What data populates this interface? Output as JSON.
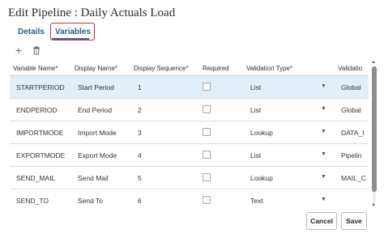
{
  "dialog": {
    "title": "Edit Pipeline : Daily Actuals Load"
  },
  "tabs": [
    {
      "label": "Details"
    },
    {
      "label": "Variables",
      "active": true
    }
  ],
  "toolbar": {
    "add_icon": "plus-icon",
    "delete_icon": "trash-icon"
  },
  "table": {
    "columns": [
      "Variable Name*",
      "Display Name*",
      "Display Sequence*",
      "Required",
      "Validation Type*",
      "Validatio"
    ],
    "rows": [
      {
        "variable": "STARTPERIOD",
        "display": "Start Period",
        "sequence": "1",
        "required": false,
        "validation_type": "List",
        "validation": "Global",
        "selected": true
      },
      {
        "variable": "ENDPERIOD",
        "display": "End Period",
        "sequence": "2",
        "required": false,
        "validation_type": "List",
        "validation": "Global"
      },
      {
        "variable": "IMPORTMODE",
        "display": "Import Mode",
        "sequence": "3",
        "required": false,
        "validation_type": "Lookup",
        "validation": "DATA_I"
      },
      {
        "variable": "EXPORTMODE",
        "display": "Export Mode",
        "sequence": "4",
        "required": false,
        "validation_type": "List",
        "validation": "Pipelin"
      },
      {
        "variable": "SEND_MAIL",
        "display": "Send Mail",
        "sequence": "5",
        "required": false,
        "validation_type": "Lookup",
        "validation": "MAIL_C"
      },
      {
        "variable": "SEND_TO",
        "display": "Send To",
        "sequence": "6",
        "required": false,
        "validation_type": "Text",
        "validation": ""
      }
    ]
  },
  "footer": {
    "cancel_label": "Cancel",
    "save_label": "Save"
  },
  "colors": {
    "accent": "#3f6a9c",
    "highlight_box": "#d62d2d",
    "selected_row": "#e2eef8"
  }
}
